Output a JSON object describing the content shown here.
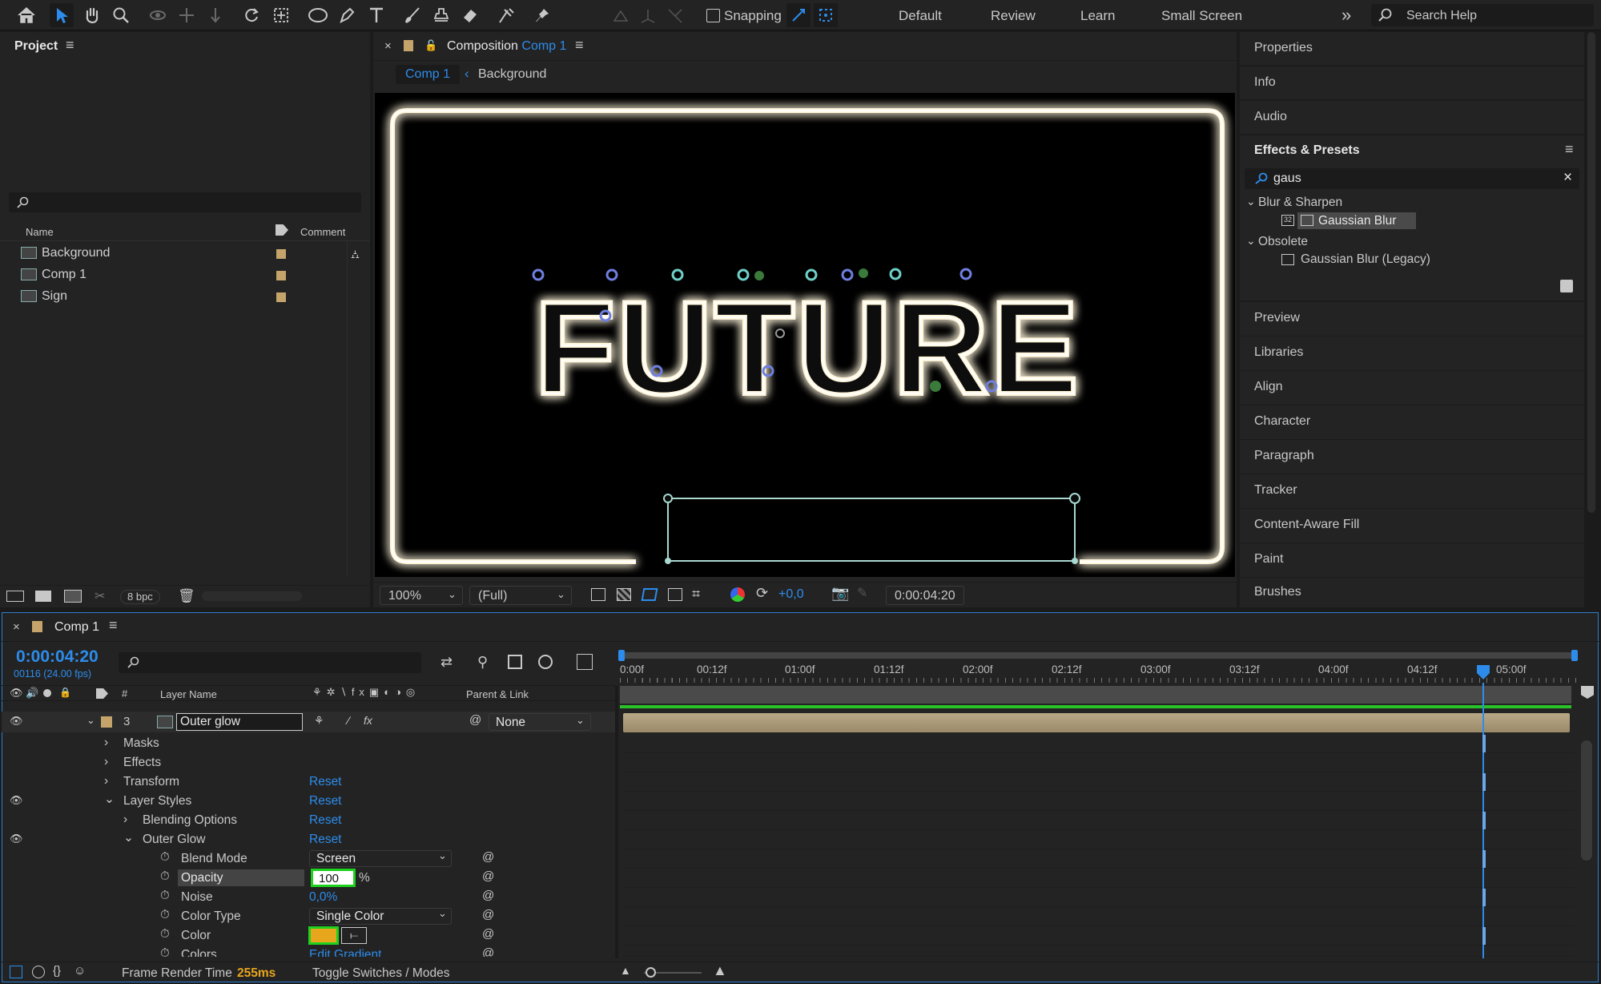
{
  "toolbar": {
    "snapping_label": "Snapping",
    "workspaces": [
      "Default",
      "Review",
      "Learn",
      "Small Screen"
    ],
    "search_placeholder": "Search Help",
    "tools": [
      "home-icon",
      "selection-tool-icon",
      "hand-tool-icon",
      "zoom-tool-icon",
      "orbit-camera-icon",
      "pan-camera-icon",
      "dolly-camera-icon",
      "rotation-tool-icon",
      "pan-behind-icon",
      "ellipse-tool-icon",
      "pen-tool-icon",
      "type-tool-icon",
      "brush-tool-icon",
      "clone-stamp-icon",
      "eraser-tool-icon",
      "roto-brush-icon",
      "puppet-pin-icon"
    ]
  },
  "project": {
    "title": "Project",
    "columns": {
      "name": "Name",
      "comment": "Comment"
    },
    "items": [
      {
        "name": "Background",
        "label_color": "#c4a46a"
      },
      {
        "name": "Comp 1",
        "label_color": "#c4a46a"
      },
      {
        "name": "Sign",
        "label_color": "#c4a46a"
      }
    ],
    "bpc": "8 bpc"
  },
  "composition": {
    "title_prefix": "Composition",
    "title_name": "Comp 1",
    "breadcrumb": [
      "Comp 1",
      "Background"
    ],
    "text": "FUTURE",
    "zoom": "100%",
    "resolution": "(Full)",
    "exposure": "+0,0",
    "timecode": "0:00:04:20"
  },
  "right_panel": {
    "items_top": [
      "Properties",
      "Info",
      "Audio"
    ],
    "effects_title": "Effects & Presets",
    "search_value": "gaus",
    "groups": [
      {
        "name": "Blur & Sharpen",
        "items": [
          "Gaussian Blur"
        ]
      },
      {
        "name": "Obsolete",
        "items": [
          "Gaussian Blur (Legacy)"
        ]
      }
    ],
    "items_bottom": [
      "Preview",
      "Libraries",
      "Align",
      "Character",
      "Paragraph",
      "Tracker",
      "Content-Aware Fill",
      "Paint",
      "Brushes"
    ]
  },
  "timeline": {
    "tab": "Comp 1",
    "timecode": "0:00:04:20",
    "frame_info": "00116 (24.00 fps)",
    "columns": {
      "num": "#",
      "layer_name": "Layer Name",
      "parent": "Parent & Link"
    },
    "ruler": [
      "0:00f",
      "00:12f",
      "01:00f",
      "01:12f",
      "02:00f",
      "02:12f",
      "03:00f",
      "03:12f",
      "04:00f",
      "04:12f",
      "05:00f"
    ],
    "layer": {
      "number": "3",
      "name": "Outer glow",
      "parent": "None"
    },
    "properties": [
      {
        "name": "Masks",
        "level": 1
      },
      {
        "name": "Effects",
        "level": 1
      },
      {
        "name": "Transform",
        "level": 1,
        "value": "Reset"
      },
      {
        "name": "Layer Styles",
        "level": 1,
        "value": "Reset"
      },
      {
        "name": "Blending Options",
        "level": 2,
        "value": "Reset"
      },
      {
        "name": "Outer Glow",
        "level": 2,
        "value": "Reset"
      },
      {
        "name": "Blend Mode",
        "level": 3,
        "value": "Screen"
      },
      {
        "name": "Opacity",
        "level": 3,
        "value": "100",
        "unit": "%"
      },
      {
        "name": "Noise",
        "level": 3,
        "value": "0,0%"
      },
      {
        "name": "Color Type",
        "level": 3,
        "value": "Single Color"
      },
      {
        "name": "Color",
        "level": 3,
        "swatch": "#e8a61c"
      },
      {
        "name": "Colors",
        "level": 3,
        "value": "Edit Gradient"
      }
    ],
    "footer": {
      "render_label": "Frame Render Time",
      "render_value": "255ms",
      "toggle": "Toggle Switches / Modes"
    }
  },
  "colors": {
    "accent": "#2d8ceb",
    "highlight": "#1ed11e",
    "glow": "#fff3d0",
    "layer_bar": "#a89878"
  }
}
